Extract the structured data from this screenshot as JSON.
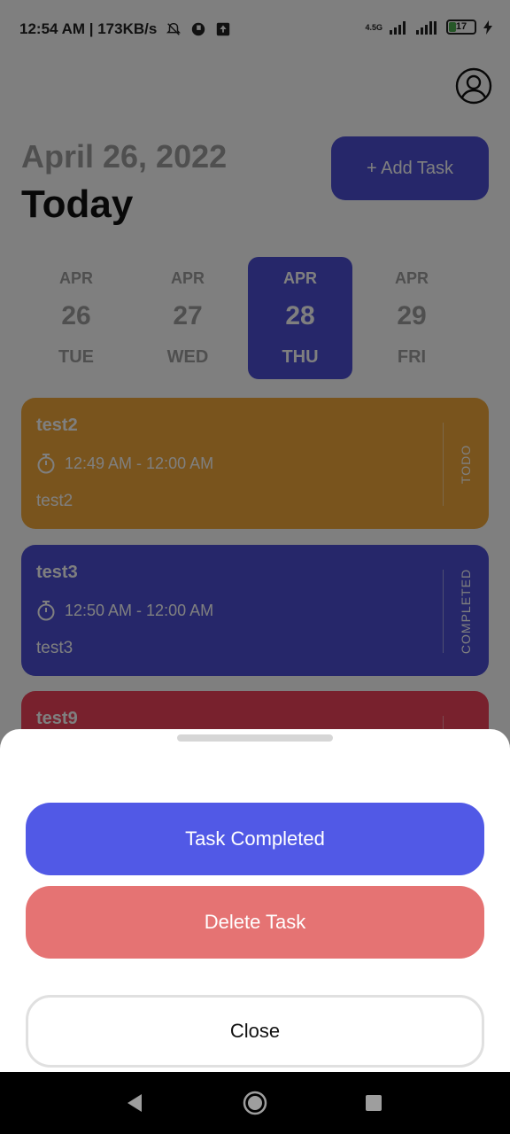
{
  "status_bar": {
    "time_speed": "12:54 AM | 173KB/s",
    "network": "4.5G",
    "battery": "17"
  },
  "header": {
    "date": "April 26, 2022",
    "today": "Today",
    "add_task": "+ Add Task"
  },
  "days": [
    {
      "month": "APR",
      "day": "26",
      "weekday": "TUE",
      "active": false
    },
    {
      "month": "APR",
      "day": "27",
      "weekday": "WED",
      "active": false
    },
    {
      "month": "APR",
      "day": "28",
      "weekday": "THU",
      "active": true
    },
    {
      "month": "APR",
      "day": "29",
      "weekday": "FRI",
      "active": false
    }
  ],
  "tasks": [
    {
      "title": "test2",
      "time": "12:49 AM - 12:00 AM",
      "note": "test2",
      "status": "TODO",
      "color": "#f2a93b"
    },
    {
      "title": "test3",
      "time": "12:50 AM - 12:00 AM",
      "note": "test3",
      "status": "COMPLETED",
      "color": "#4c4fd4"
    },
    {
      "title": "test9",
      "time": "",
      "note": "",
      "status": "",
      "color": "#f0435a"
    }
  ],
  "sheet": {
    "complete": "Task Completed",
    "delete": "Delete Task",
    "close": "Close"
  },
  "icons": {
    "theme": "moon-icon",
    "profile": "profile-icon",
    "timer": "timer-icon",
    "nav_back": "back-icon",
    "nav_home": "home-icon",
    "nav_recent": "recent-apps-icon"
  },
  "colors": {
    "primary": "#4c4fd4",
    "todo": "#f2a93b",
    "danger": "#e57373",
    "button_complete": "#5159e6"
  }
}
